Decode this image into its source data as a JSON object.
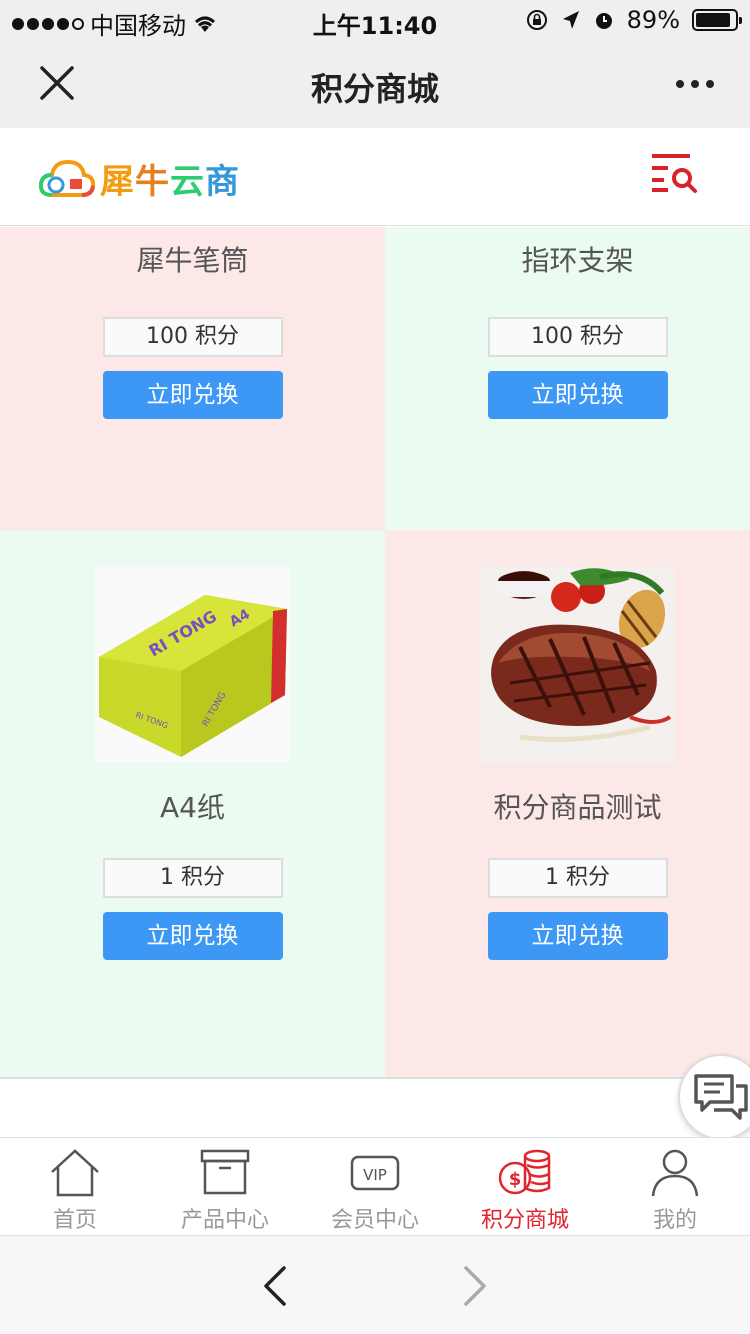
{
  "status_bar": {
    "carrier": "中国移动",
    "time": "上午11:40",
    "battery": "89%",
    "battery_level": 0.89
  },
  "nav": {
    "title": "积分商城",
    "icons": {
      "close": "close-icon",
      "more": "more-icon"
    }
  },
  "site": {
    "logo_text": "犀牛云商",
    "menu_icon": "menu-search-icon"
  },
  "products": [
    {
      "name": "犀牛笔筒",
      "points": "100 积分",
      "button": "立即兑换"
    },
    {
      "name": "指环支架",
      "points": "100 积分",
      "button": "立即兑换"
    },
    {
      "name": "A4纸",
      "points": "1 积分",
      "button": "立即兑换",
      "image": "a4-paper-box-image"
    },
    {
      "name": "积分商品测试",
      "points": "1 积分",
      "button": "立即兑换",
      "image": "steak-image"
    }
  ],
  "tabbar": {
    "items": [
      {
        "label": "首页",
        "icon": "home-icon"
      },
      {
        "label": "产品中心",
        "icon": "box-icon"
      },
      {
        "label": "会员中心",
        "icon": "vip-icon",
        "badge": "VIP"
      },
      {
        "label": "积分商城",
        "icon": "coins-icon",
        "active": true
      },
      {
        "label": "我的",
        "icon": "user-icon"
      }
    ]
  },
  "colors": {
    "accent_blue": "#3d98f5",
    "active_red": "#e0252c",
    "pink_cell": "#fde8e8",
    "green_cell": "#ebfbf1"
  }
}
